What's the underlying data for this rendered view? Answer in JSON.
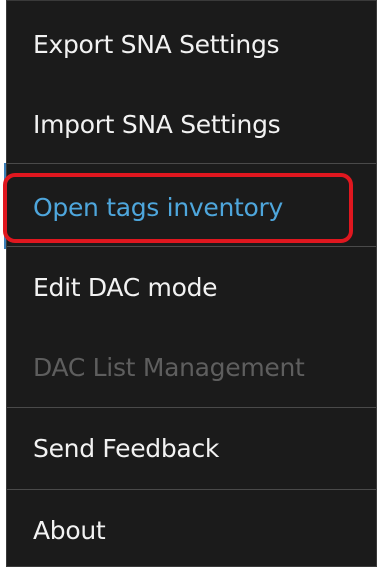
{
  "menu": {
    "items": [
      {
        "label": "Export SNA Settings",
        "state": "enabled"
      },
      {
        "label": "Import SNA Settings",
        "state": "enabled"
      },
      {
        "label": "Open tags inventory",
        "state": "highlighted"
      },
      {
        "label": "Edit DAC mode",
        "state": "enabled"
      },
      {
        "label": "DAC List Management",
        "state": "disabled"
      },
      {
        "label": "Send Feedback",
        "state": "enabled"
      },
      {
        "label": "About",
        "state": "enabled"
      }
    ]
  },
  "colors": {
    "background": "#1b1b1b",
    "text": "#f2f2f2",
    "disabled_text": "#5e5e5e",
    "highlight_text": "#4ea6dc",
    "highlight_border": "#e0171f",
    "separator": "#4a4a4a"
  }
}
